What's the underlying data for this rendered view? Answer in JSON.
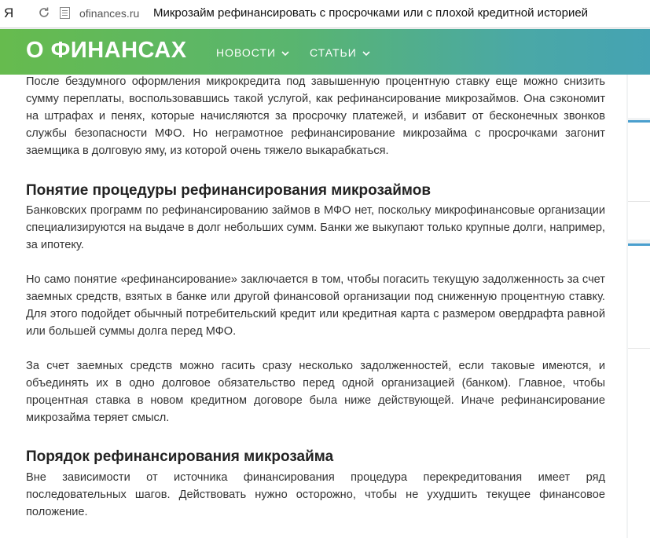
{
  "browser": {
    "brand_glyph": "Я",
    "domain": "ofinances.ru",
    "page_title": "Микрозайм рефинансировать с просрочками или с плохой кредитной историей"
  },
  "site": {
    "logo": "О ФИНАНСАХ",
    "nav": [
      {
        "label": "НОВОСТИ"
      },
      {
        "label": "СТАТЬИ"
      }
    ],
    "accent_color": "#4a9fce"
  },
  "article": {
    "intro": "После бездумного оформления микрокредита под завышенную процентную ставку еще можно снизить сумму переплаты, воспользовавшись такой услугой, как рефинансирование микрозаймов. Она сэкономит на штрафах и пенях, которые начисляются за просрочку платежей, и избавит от бесконечных звонков службы безопасности МФО. Но неграмотное рефинансирование микрозайма с просрочками загонит заемщика в долговую яму, из которой очень тяжело выкарабкаться.",
    "heading1": "Понятие процедуры рефинансирования микрозаймов",
    "para1": "Банковских программ по рефинансированию займов в МФО нет, поскольку микрофинансовые организации специализируются на выдаче в долг небольших сумм. Банки же выкупают только крупные долги, например, за ипотеку.",
    "para2": "Но само понятие «рефинансирование» заключается в том, чтобы погасить текущую задолженность за счет заемных средств, взятых в банке или другой финансовой организации под сниженную процентную ставку. Для этого подойдет обычный потребительский кредит или кредитная карта с размером овердрафта равной или большей суммы долга перед МФО.",
    "para3": "За счет заемных средств можно гасить сразу несколько задолженностей, если таковые имеются, и объединять их в одно долговое обязательство перед одной организацией (банком). Главное, чтобы процентная ставка в новом кредитном договоре была ниже действующей. Иначе рефинансирование микрозайма теряет смысл.",
    "heading2": "Порядок рефинансирования микрозайма",
    "para4": "Вне зависимости от источника финансирования процедура перекредитования имеет ряд последовательных шагов. Действовать нужно осторожно, чтобы не ухудшить текущее финансовое положение."
  }
}
